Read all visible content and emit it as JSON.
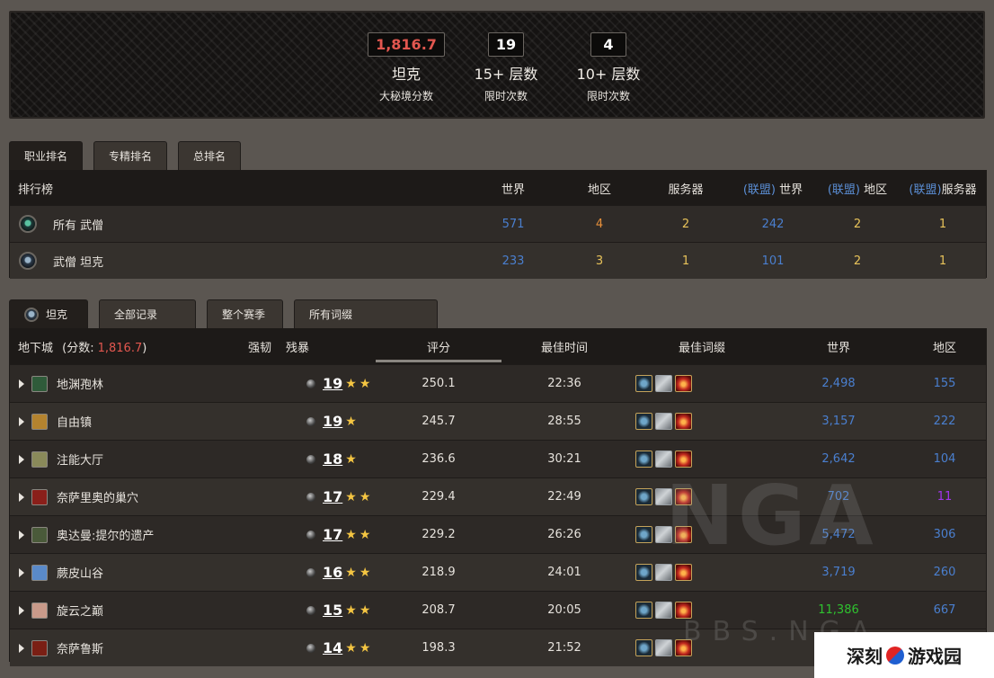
{
  "header": {
    "stats": [
      {
        "value": "1,816.7",
        "big": "坦克",
        "small": "大秘境分数",
        "color": "red"
      },
      {
        "value": "19",
        "big": "15+ 层数",
        "small": "限时次数",
        "color": "white"
      },
      {
        "value": "4",
        "big": "10+ 层数",
        "small": "限时次数",
        "color": "white"
      }
    ]
  },
  "rank_tabs": [
    "职业排名",
    "专精排名",
    "总排名"
  ],
  "ranking": {
    "headers": {
      "label": "排行榜",
      "world": "世界",
      "region": "地区",
      "server": "服务器",
      "alliance_prefix": "(联盟)",
      "a_world": "世界",
      "a_region": "地区",
      "a_server": "服务器"
    },
    "rows": [
      {
        "name": "所有 武僧",
        "world": "571",
        "region": "4",
        "server": "2",
        "a_world": "242",
        "a_region": "2",
        "a_server": "1",
        "icon": "monk-class-icon"
      },
      {
        "name": "武僧 坦克",
        "world": "233",
        "region": "3",
        "server": "1",
        "a_world": "101",
        "a_region": "2",
        "a_server": "1",
        "icon": "tank-spec-icon"
      }
    ]
  },
  "dungeon_tabs": [
    "坦克",
    "全部记录",
    "整个赛季",
    "所有词缀"
  ],
  "dungeons": {
    "headers": {
      "dungeon": "地下城",
      "score_label": "(分数:",
      "score_value": "1,816.7",
      "score_close": ")",
      "fortified": "强韧",
      "tyrannical": "残暴",
      "rating": "评分",
      "best_time": "最佳时间",
      "best_affixes": "最佳词缀",
      "world": "世界",
      "region": "地区"
    },
    "rows": [
      {
        "name": "地渊孢林",
        "level": "19",
        "stars": 2,
        "rating": "250.1",
        "time": "22:36",
        "world": "2,498",
        "region": "155",
        "world_color": "blue",
        "region_color": "blue",
        "icon_color": "#2f5b3a"
      },
      {
        "name": "自由镇",
        "level": "19",
        "stars": 1,
        "rating": "245.7",
        "time": "28:55",
        "world": "3,157",
        "region": "222",
        "world_color": "blue",
        "region_color": "blue",
        "icon_color": "#b4832f"
      },
      {
        "name": "注能大厅",
        "level": "18",
        "stars": 1,
        "rating": "236.6",
        "time": "30:21",
        "world": "2,642",
        "region": "104",
        "world_color": "blue",
        "region_color": "blue",
        "icon_color": "#8a8a5a"
      },
      {
        "name": "奈萨里奥的巢穴",
        "level": "17",
        "stars": 2,
        "rating": "229.4",
        "time": "22:49",
        "world": "702",
        "region": "11",
        "world_color": "blue",
        "region_color": "purple",
        "icon_color": "#8a1f1a"
      },
      {
        "name": "奥达曼:提尔的遗产",
        "level": "17",
        "stars": 2,
        "rating": "229.2",
        "time": "26:26",
        "world": "5,472",
        "region": "306",
        "world_color": "blue",
        "region_color": "blue",
        "icon_color": "#4a5a3a"
      },
      {
        "name": "蕨皮山谷",
        "level": "16",
        "stars": 2,
        "rating": "218.9",
        "time": "24:01",
        "world": "3,719",
        "region": "260",
        "world_color": "blue",
        "region_color": "blue",
        "icon_color": "#5a8ac9"
      },
      {
        "name": "旋云之巅",
        "level": "15",
        "stars": 2,
        "rating": "208.7",
        "time": "20:05",
        "world": "11,386",
        "region": "667",
        "world_color": "green",
        "region_color": "blue",
        "icon_color": "#c99a8a"
      },
      {
        "name": "奈萨鲁斯",
        "level": "14",
        "stars": 2,
        "rating": "198.3",
        "time": "21:52",
        "world": "",
        "region": "",
        "world_color": "blue",
        "region_color": "blue",
        "icon_color": "#7a1f14"
      }
    ]
  },
  "star_glyph": "★",
  "watermark": {
    "main": "NGA",
    "sub": "BBS.NGA"
  },
  "corner_logo": {
    "left": "深刻",
    "right": "游戏园"
  },
  "colors": {
    "accent_red": "#e2574f",
    "rank_blue": "#4a7fcf",
    "rank_orange": "#e8903a",
    "rank_yellow": "#e8c35a",
    "rank_green": "#2fc22f",
    "rank_purple": "#a335ee"
  }
}
